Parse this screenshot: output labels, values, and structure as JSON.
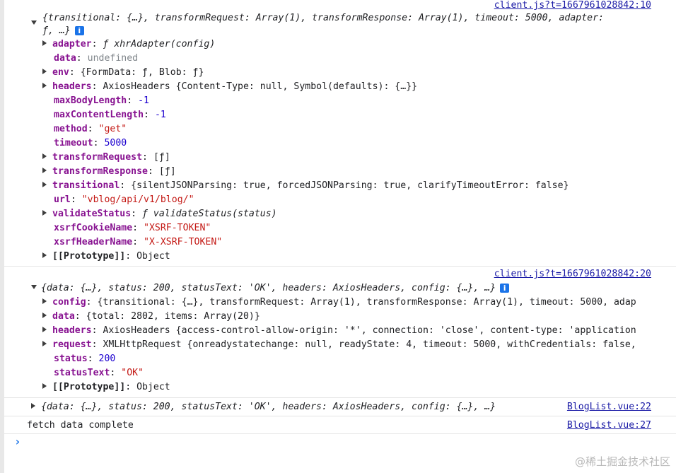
{
  "sources": {
    "first": "client.js?t=1667961028842:10",
    "second": "client.js?t=1667961028842:20",
    "third": "BlogList.vue:22",
    "fourth": "BlogList.vue:27"
  },
  "first_log": {
    "summary_line1": "{transitional: {…}, transformRequest: Array(1), transformResponse: Array(1), timeout: 5000, adapter:",
    "summary_line2": "ƒ, …}",
    "info": "i",
    "props": [
      {
        "key": "adapter",
        "value": "ƒ xhrAdapter(config)"
      },
      {
        "key": "data",
        "value": "undefined"
      },
      {
        "key": "env",
        "value": "{FormData: ƒ, Blob: ƒ}"
      },
      {
        "key": "headers",
        "value": "AxiosHeaders {Content-Type: null, Symbol(defaults): {…}}"
      },
      {
        "key": "maxBodyLength",
        "value": "-1"
      },
      {
        "key": "maxContentLength",
        "value": "-1"
      },
      {
        "key": "method",
        "value": "\"get\""
      },
      {
        "key": "timeout",
        "value": "5000"
      },
      {
        "key": "transformRequest",
        "value": "[ƒ]"
      },
      {
        "key": "transformResponse",
        "value": "[ƒ]"
      },
      {
        "key": "transitional",
        "value": "{silentJSONParsing: true, forcedJSONParsing: true, clarifyTimeoutError: false}"
      },
      {
        "key": "url",
        "value": "\"vblog/api/v1/blog/\""
      },
      {
        "key": "validateStatus",
        "value": "ƒ validateStatus(status)"
      },
      {
        "key": "xsrfCookieName",
        "value": "\"XSRF-TOKEN\""
      },
      {
        "key": "xsrfHeaderName",
        "value": "\"X-XSRF-TOKEN\""
      },
      {
        "key": "[[Prototype]]",
        "value": "Object"
      }
    ]
  },
  "second_log": {
    "summary": "{data: {…}, status: 200, statusText: 'OK', headers: AxiosHeaders, config: {…}, …}",
    "info": "i",
    "props": [
      {
        "key": "config",
        "value": "{transitional: {…}, transformRequest: Array(1), transformResponse: Array(1), timeout: 5000, adap"
      },
      {
        "key": "data",
        "value": "{total: 2802, items: Array(20)}"
      },
      {
        "key": "headers",
        "value": "AxiosHeaders {access-control-allow-origin: '*', connection: 'close', content-type: 'application"
      },
      {
        "key": "request",
        "value": "XMLHttpRequest {onreadystatechange: null, readyState: 4, timeout: 5000, withCredentials: false,"
      },
      {
        "key": "status",
        "value": "200"
      },
      {
        "key": "statusText",
        "value": "\"OK\""
      },
      {
        "key": "[[Prototype]]",
        "value": "Object"
      }
    ]
  },
  "third_log": {
    "summary": "{data: {…}, status: 200, statusText: 'OK', headers: AxiosHeaders, config: {…}, …}"
  },
  "fourth_log": {
    "text": "fetch data complete"
  },
  "prompt": "›",
  "watermark": "@稀土掘金技术社区"
}
